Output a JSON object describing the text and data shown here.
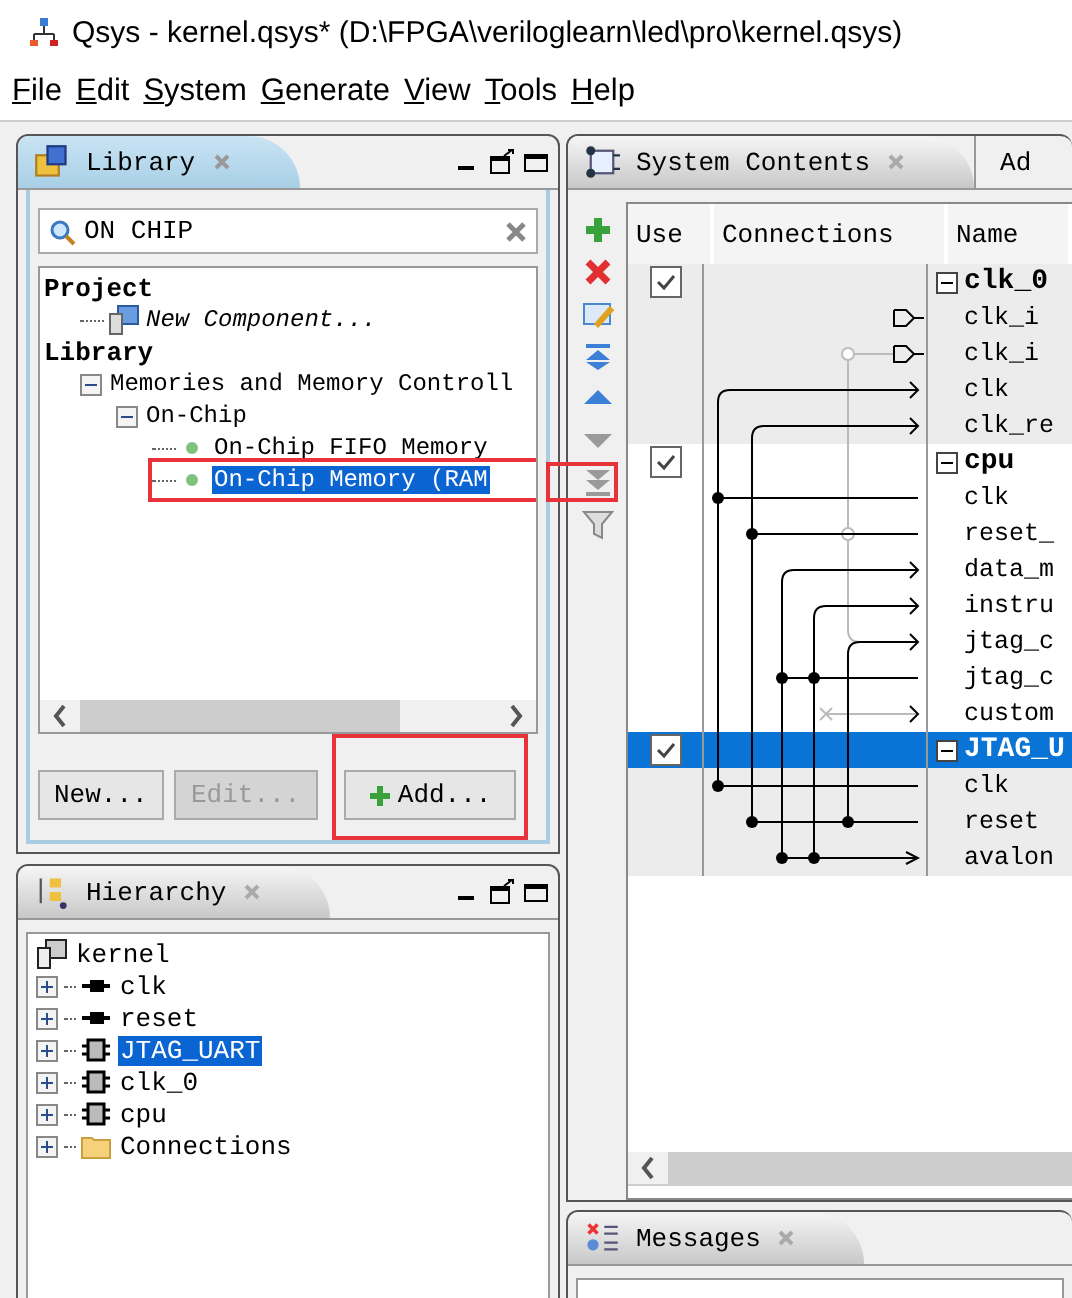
{
  "window": {
    "title": "Qsys - kernel.qsys* (D:\\FPGA\\veriloglearn\\led\\pro\\kernel.qsys)"
  },
  "menu": [
    "File",
    "Edit",
    "System",
    "Generate",
    "View",
    "Tools",
    "Help"
  ],
  "library": {
    "title": "Library",
    "search": {
      "value": "ON CHIP"
    },
    "tree": [
      {
        "label": "Project",
        "kind": "heading",
        "children": [
          {
            "label": "New Component...",
            "kind": "component"
          }
        ]
      },
      {
        "label": "Library",
        "kind": "heading",
        "children": [
          {
            "label": "Memories and Memory Controll",
            "kind": "category",
            "expanded": true,
            "children": [
              {
                "label": "On-Chip",
                "kind": "category",
                "expanded": true,
                "children": [
                  {
                    "label": "On-Chip FIFO Memory",
                    "kind": "ip",
                    "selected": false
                  },
                  {
                    "label": "On-Chip Memory (RAM",
                    "kind": "ip",
                    "selected": true,
                    "highlighted": true
                  }
                ]
              }
            ]
          }
        ]
      }
    ],
    "buttons": [
      {
        "label": "New...",
        "disabled": false,
        "kind": "new"
      },
      {
        "label": "Edit...",
        "disabled": true,
        "kind": "edit"
      },
      {
        "label": "Add...",
        "disabled": false,
        "kind": "add",
        "highlighted": true
      }
    ]
  },
  "hierarchy": {
    "title": "Hierarchy",
    "root": "kernel",
    "children": [
      {
        "label": "clk",
        "kind": "port",
        "selected": false
      },
      {
        "label": "reset",
        "kind": "port",
        "selected": false
      },
      {
        "label": "JTAG_UART",
        "kind": "module",
        "selected": true
      },
      {
        "label": "clk_0",
        "kind": "module",
        "selected": false
      },
      {
        "label": "cpu",
        "kind": "module",
        "selected": false
      },
      {
        "label": "Connections",
        "kind": "folder",
        "selected": false
      }
    ]
  },
  "system": {
    "tabs": [
      {
        "label": "System Contents",
        "selected": true
      },
      {
        "label": "Ad",
        "selected": false
      }
    ],
    "toolbar": [
      {
        "kind": "add",
        "disabled": false
      },
      {
        "kind": "remove",
        "disabled": false
      },
      {
        "kind": "edit",
        "disabled": false
      },
      {
        "kind": "move-top",
        "disabled": false
      },
      {
        "kind": "move-up",
        "disabled": false
      },
      {
        "kind": "move-down",
        "disabled": true
      },
      {
        "kind": "move-bottom",
        "disabled": true,
        "highlighted": true
      },
      {
        "kind": "filter",
        "disabled": false
      }
    ],
    "columns": [
      "Use",
      "Connections",
      "Name"
    ],
    "rows": [
      {
        "kind": "module",
        "name": "clk_0",
        "checked": true,
        "selected": false
      },
      {
        "kind": "port",
        "name": "clk_i"
      },
      {
        "kind": "port",
        "name": "clk_i"
      },
      {
        "kind": "port",
        "name": "clk"
      },
      {
        "kind": "port",
        "name": "clk_re"
      },
      {
        "kind": "module",
        "name": "cpu",
        "checked": true,
        "selected": false
      },
      {
        "kind": "port",
        "name": "clk"
      },
      {
        "kind": "port",
        "name": "reset_"
      },
      {
        "kind": "port",
        "name": "data_m"
      },
      {
        "kind": "port",
        "name": "instru"
      },
      {
        "kind": "port",
        "name": "jtag_c"
      },
      {
        "kind": "port",
        "name": "jtag_c"
      },
      {
        "kind": "port",
        "name": "custom"
      },
      {
        "kind": "module",
        "name": "JTAG_U",
        "checked": true,
        "selected": true
      },
      {
        "kind": "port",
        "name": "clk"
      },
      {
        "kind": "port",
        "name": "reset"
      },
      {
        "kind": "port",
        "name": "avalon"
      }
    ]
  },
  "messages": {
    "title": "Messages"
  }
}
